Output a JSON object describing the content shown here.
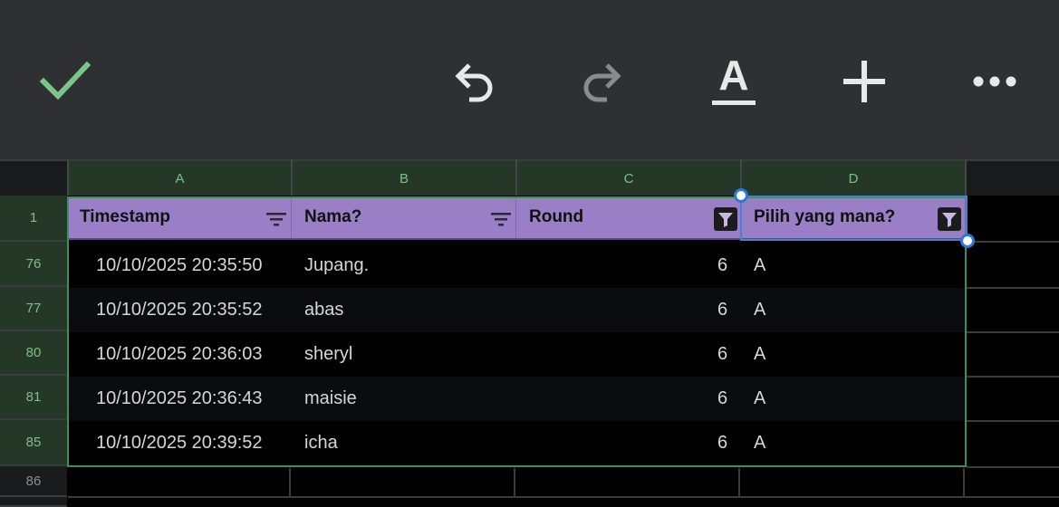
{
  "toolbar": {
    "confirm_icon": "check-icon",
    "undo_icon": "undo-icon",
    "redo_icon": "redo-icon",
    "text_format_label": "A",
    "insert_icon": "plus-icon",
    "more_icon": "more-icon",
    "colors": {
      "check": "#7bc48b",
      "icon": "#e8e8e8",
      "disabled": "#8a8b8e"
    }
  },
  "columns": [
    "A",
    "B",
    "C",
    "D"
  ],
  "header_row": {
    "row_number": "1",
    "cells": [
      "Timestamp",
      "Nama?",
      "Round",
      "Pilih yang mana?"
    ],
    "color": "#9a7fc6"
  },
  "rows": [
    {
      "row_number": "76",
      "timestamp": "10/10/2025 20:35:50",
      "nama": "Jupang.",
      "round": "6",
      "pilih": "A"
    },
    {
      "row_number": "77",
      "timestamp": "10/10/2025 20:35:52",
      "nama": "abas",
      "round": "6",
      "pilih": "A"
    },
    {
      "row_number": "80",
      "timestamp": "10/10/2025 20:36:03",
      "nama": "sheryl",
      "round": "6",
      "pilih": "A"
    },
    {
      "row_number": "81",
      "timestamp": "10/10/2025 20:36:43",
      "nama": "maisie",
      "round": "6",
      "pilih": "A"
    },
    {
      "row_number": "85",
      "timestamp": "10/10/2025 20:39:52",
      "nama": "icha",
      "round": "6",
      "pilih": "A"
    }
  ],
  "empty_row_number": "86"
}
